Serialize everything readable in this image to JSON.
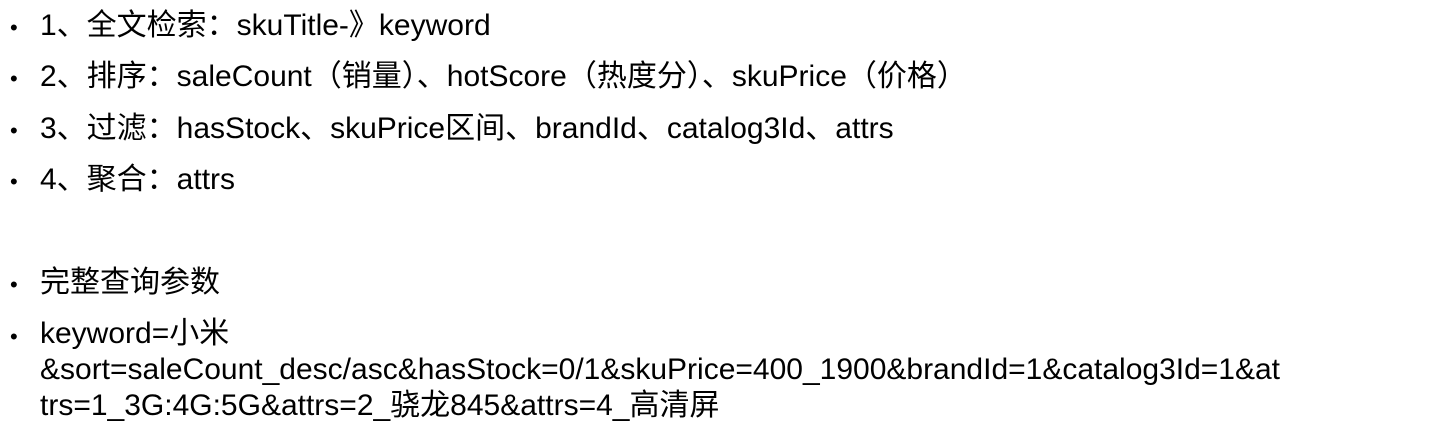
{
  "items": [
    {
      "bullet": "•",
      "text": "1、全文检索：skuTitle-》keyword"
    },
    {
      "bullet": "•",
      "text": "2、排序：saleCount（销量）、hotScore（热度分）、skuPrice（价格）"
    },
    {
      "bullet": "•",
      "text": "3、过滤：hasStock、skuPrice区间、brandId、catalog3Id、attrs"
    },
    {
      "bullet": "•",
      "text": "4、聚合：attrs"
    },
    {
      "bullet": "•",
      "text": "完整查询参数"
    }
  ],
  "query": {
    "bullet": "•",
    "lines": [
      "keyword=小米",
      "&sort=saleCount_desc/asc&hasStock=0/1&skuPrice=400_1900&brandId=1&catalog3Id=1&at",
      "trs=1_3G:4G:5G&attrs=2_骁龙845&attrs=4_高清屏"
    ]
  }
}
